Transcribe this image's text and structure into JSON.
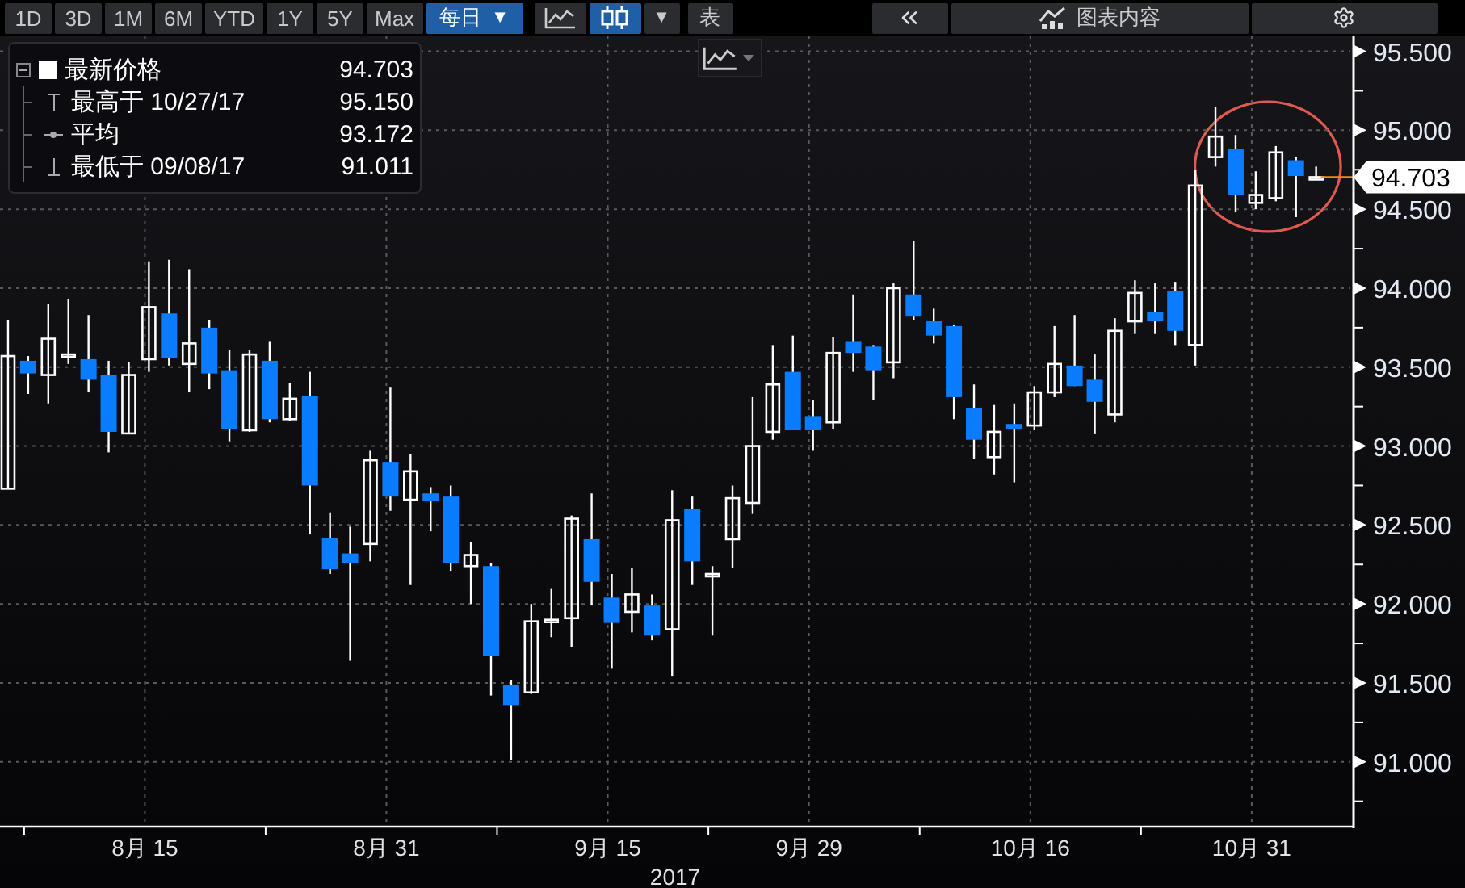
{
  "toolbar": {
    "ranges": [
      {
        "label": "1D",
        "selected": false
      },
      {
        "label": "3D",
        "selected": false
      },
      {
        "label": "1M",
        "selected": false
      },
      {
        "label": "6M",
        "selected": false
      },
      {
        "label": "YTD",
        "selected": false
      },
      {
        "label": "1Y",
        "selected": false
      },
      {
        "label": "5Y",
        "selected": false
      },
      {
        "label": "Max",
        "selected": false
      }
    ],
    "frequency": {
      "label": "每日",
      "caret": "▼"
    },
    "chart_types": [
      {
        "kind": "line",
        "selected": false
      },
      {
        "kind": "candle",
        "selected": true
      }
    ],
    "type_caret": "▼",
    "table_button": "表",
    "contents_button": "图表内容"
  },
  "legend": {
    "items": [
      {
        "kind": "last",
        "label": "最新价格",
        "value": "94.703"
      },
      {
        "kind": "high",
        "label": "最高于 10/27/17",
        "value": "95.150"
      },
      {
        "kind": "average",
        "label": "平均",
        "value": "93.172"
      },
      {
        "kind": "low",
        "label": "最低于 09/08/17",
        "value": "91.011"
      }
    ]
  },
  "chart": {
    "last_price_label": "94.703",
    "highlighted_recent": true,
    "chart_data": {
      "type": "candlestick",
      "grid": true,
      "xlabel": "2017",
      "ylim": [
        90.6,
        95.6
      ],
      "categories": [
        null,
        null,
        null,
        null,
        null,
        null,
        null,
        "8月 15",
        null,
        null,
        null,
        null,
        null,
        null,
        null,
        null,
        null,
        null,
        null,
        "8月 31",
        null,
        null,
        null,
        null,
        null,
        null,
        null,
        null,
        null,
        null,
        "9月 15",
        null,
        null,
        null,
        null,
        null,
        null,
        null,
        null,
        null,
        "9月 29",
        null,
        null,
        null,
        null,
        null,
        null,
        null,
        null,
        null,
        null,
        "10月 16",
        null,
        null,
        null,
        null,
        null,
        null,
        null,
        null,
        null,
        null,
        "10月 31",
        null,
        null,
        null
      ],
      "yticks": [
        {
          "value": 91,
          "label": "91.000"
        },
        {
          "value": 91.5,
          "label": "91.500"
        },
        {
          "value": 92,
          "label": "92.000"
        },
        {
          "value": 92.5,
          "label": "92.500"
        },
        {
          "value": 93,
          "label": "93.000"
        },
        {
          "value": 93.5,
          "label": "93.500"
        },
        {
          "value": 94,
          "label": "94.000"
        },
        {
          "value": 94.5,
          "label": "94.500"
        },
        {
          "value": 95,
          "label": "95.000"
        },
        {
          "value": 95.5,
          "label": "95.500"
        }
      ],
      "series": [
        {
          "ohlc": [
            [
              92.73,
              93.8,
              92.73,
              93.57
            ],
            [
              93.54,
              93.57,
              93.33,
              93.46
            ],
            [
              93.45,
              93.9,
              93.27,
              93.68
            ],
            [
              93.58,
              93.93,
              93.52,
              93.58
            ],
            [
              93.55,
              93.83,
              93.34,
              93.42
            ],
            [
              93.45,
              93.54,
              92.96,
              93.09
            ],
            [
              93.08,
              93.53,
              93.08,
              93.45
            ],
            [
              93.55,
              94.17,
              93.47,
              93.88
            ],
            [
              93.84,
              94.18,
              93.51,
              93.56
            ],
            [
              93.52,
              94.12,
              93.34,
              93.65
            ],
            [
              93.75,
              93.8,
              93.36,
              93.46
            ],
            [
              93.48,
              93.61,
              93.03,
              93.11
            ],
            [
              93.1,
              93.61,
              93.09,
              93.58
            ],
            [
              93.54,
              93.66,
              93.15,
              93.17
            ],
            [
              93.17,
              93.4,
              93.16,
              93.3
            ],
            [
              93.32,
              93.47,
              92.44,
              92.75
            ],
            [
              92.42,
              92.58,
              92.19,
              92.22
            ],
            [
              92.32,
              92.49,
              91.64,
              92.26
            ],
            [
              92.38,
              92.97,
              92.27,
              92.91
            ],
            [
              92.9,
              93.37,
              92.59,
              92.68
            ],
            [
              92.66,
              92.95,
              92.12,
              92.84
            ],
            [
              92.7,
              92.74,
              92.46,
              92.65
            ],
            [
              92.68,
              92.75,
              92.21,
              92.26
            ],
            [
              92.24,
              92.39,
              92.0,
              92.31
            ],
            [
              92.24,
              92.26,
              91.42,
              91.67
            ],
            [
              91.49,
              91.52,
              91.01,
              91.36
            ],
            [
              91.44,
              92.0,
              91.43,
              91.89
            ],
            [
              91.89,
              92.1,
              91.79,
              91.9
            ],
            [
              91.91,
              92.56,
              91.73,
              92.54
            ],
            [
              92.41,
              92.7,
              91.99,
              92.14
            ],
            [
              92.04,
              92.19,
              91.59,
              91.88
            ],
            [
              91.95,
              92.23,
              91.82,
              92.06
            ],
            [
              91.99,
              92.06,
              91.77,
              91.8
            ],
            [
              91.84,
              92.72,
              91.54,
              92.53
            ],
            [
              92.6,
              92.68,
              92.12,
              92.27
            ],
            [
              92.19,
              92.24,
              91.8,
              92.19
            ],
            [
              92.41,
              92.75,
              92.23,
              92.67
            ],
            [
              92.64,
              93.31,
              92.57,
              93.0
            ],
            [
              93.09,
              93.64,
              93.04,
              93.39
            ],
            [
              93.47,
              93.7,
              93.1,
              93.1
            ],
            [
              93.19,
              93.29,
              92.97,
              93.1
            ],
            [
              93.15,
              93.69,
              93.11,
              93.59
            ],
            [
              93.66,
              93.96,
              93.47,
              93.59
            ],
            [
              93.63,
              93.64,
              93.29,
              93.48
            ],
            [
              93.53,
              94.03,
              93.43,
              94.0
            ],
            [
              93.96,
              94.3,
              93.8,
              93.82
            ],
            [
              93.79,
              93.87,
              93.65,
              93.7
            ],
            [
              93.76,
              93.77,
              93.17,
              93.31
            ],
            [
              93.24,
              93.39,
              92.92,
              93.04
            ],
            [
              92.93,
              93.26,
              92.82,
              93.09
            ],
            [
              93.14,
              93.27,
              92.77,
              93.11
            ],
            [
              93.13,
              93.38,
              93.1,
              93.34
            ],
            [
              93.34,
              93.76,
              93.31,
              93.52
            ],
            [
              93.51,
              93.83,
              93.38,
              93.38
            ],
            [
              93.42,
              93.58,
              93.08,
              93.28
            ],
            [
              93.2,
              93.81,
              93.15,
              93.73
            ],
            [
              93.79,
              94.05,
              93.71,
              93.97
            ],
            [
              93.85,
              94.03,
              93.71,
              93.79
            ],
            [
              93.98,
              94.04,
              93.64,
              93.73
            ],
            [
              93.64,
              94.75,
              93.51,
              94.65
            ],
            [
              94.83,
              95.15,
              94.77,
              94.96
            ],
            [
              94.88,
              94.97,
              94.48,
              94.59
            ],
            [
              94.54,
              94.74,
              94.5,
              94.59
            ],
            [
              94.57,
              94.9,
              94.55,
              94.86
            ],
            [
              94.81,
              94.83,
              94.45,
              94.71
            ],
            [
              94.703,
              94.77,
              94.69,
              94.703
            ]
          ]
        }
      ]
    }
  }
}
